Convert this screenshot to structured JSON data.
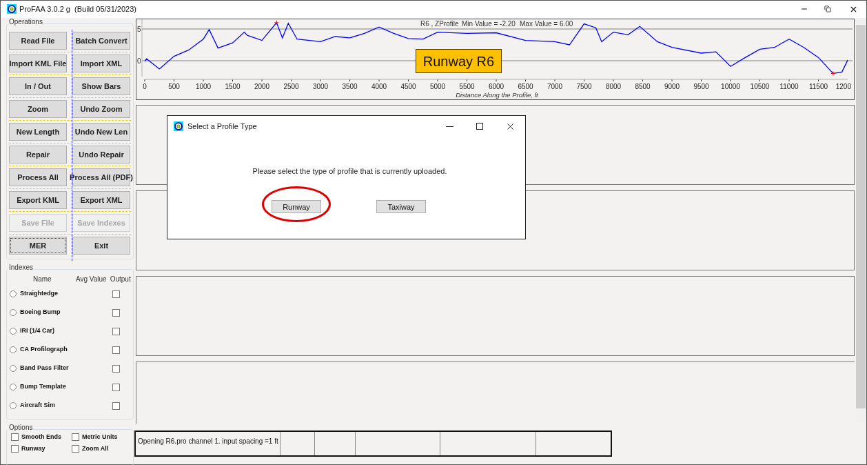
{
  "window": {
    "title": "ProFAA 3.0.2 g  (Build 05/31/2023)"
  },
  "operations": {
    "title": "Operations",
    "buttons": [
      {
        "label": "Read File",
        "disabled": false,
        "focused": false
      },
      {
        "label": "Batch Convert",
        "disabled": false,
        "focused": false
      },
      {
        "label": "Import KML File",
        "disabled": false,
        "focused": false
      },
      {
        "label": "Import XML",
        "disabled": false,
        "focused": false
      },
      {
        "label": "In / Out",
        "disabled": false,
        "focused": false
      },
      {
        "label": "Show Bars",
        "disabled": false,
        "focused": false
      },
      {
        "label": "Zoom",
        "disabled": false,
        "focused": false
      },
      {
        "label": "Undo Zoom",
        "disabled": false,
        "focused": false
      },
      {
        "label": "New Length",
        "disabled": false,
        "focused": false
      },
      {
        "label": "Undo New Len",
        "disabled": false,
        "focused": false
      },
      {
        "label": "Repair",
        "disabled": false,
        "focused": false
      },
      {
        "label": "Undo Repair",
        "disabled": false,
        "focused": false
      },
      {
        "label": "Process All",
        "disabled": false,
        "focused": false
      },
      {
        "label": "Process All (PDF)",
        "disabled": false,
        "focused": false
      },
      {
        "label": "Export KML",
        "disabled": false,
        "focused": false
      },
      {
        "label": "Export XML",
        "disabled": false,
        "focused": false
      },
      {
        "label": "Save File",
        "disabled": true,
        "focused": false
      },
      {
        "label": "Save Indexes",
        "disabled": true,
        "focused": false
      },
      {
        "label": "MER",
        "disabled": false,
        "focused": true
      },
      {
        "label": "Exit",
        "disabled": false,
        "focused": false
      }
    ]
  },
  "indexes": {
    "title": "Indexes",
    "columns": [
      "Name",
      "Avg Value",
      "Output"
    ],
    "rows": [
      {
        "name": "Straightedge",
        "selected": false,
        "output": false
      },
      {
        "name": "Boeing Bump",
        "selected": false,
        "output": false
      },
      {
        "name": "IRI (1/4 Car)",
        "selected": false,
        "output": false
      },
      {
        "name": "CA Profilograph",
        "selected": false,
        "output": false
      },
      {
        "name": "Band Pass Filter",
        "selected": false,
        "output": false
      },
      {
        "name": "Bump Template",
        "selected": false,
        "output": false
      },
      {
        "name": "Aircraft Sim",
        "selected": false,
        "output": false
      }
    ]
  },
  "options": {
    "title": "Options",
    "items": [
      {
        "label": "Smooth Ends",
        "checked": false
      },
      {
        "label": "Metric Units",
        "checked": false
      },
      {
        "label": "Runway",
        "checked": false
      },
      {
        "label": "Zoom All",
        "checked": false
      }
    ]
  },
  "profile_panel": {
    "overlay_label": "Runway R6",
    "chart_data": {
      "type": "line",
      "title": "R6 , ZProfile",
      "xlabel": "Distance Along the Profile, ft",
      "annotations": [
        "Min Value = -2.20",
        "Max Value = 6.00"
      ],
      "x": [
        0,
        30,
        250,
        500,
        750,
        1000,
        1100,
        1250,
        1500,
        1700,
        1750,
        2000,
        2250,
        2350,
        2450,
        2600,
        3000,
        3250,
        3500,
        3750,
        4000,
        4250,
        4500,
        4750,
        5000,
        5500,
        6000,
        6500,
        7000,
        7250,
        7500,
        7700,
        7800,
        8000,
        8250,
        8450,
        8750,
        9000,
        9500,
        9750,
        10000,
        10250,
        10500,
        10750,
        11000,
        11250,
        11500,
        11750,
        11900,
        12000
      ],
      "series": [
        {
          "color": "#0000ff",
          "values": [
            -0.1,
            0.3,
            -1.3,
            0.7,
            1.7,
            3.4,
            4.9,
            2.0,
            2.8,
            4.5,
            4.0,
            3.2,
            6.0,
            3.6,
            5.9,
            3.4,
            3.0,
            3.8,
            3.6,
            4.3,
            5.3,
            4.3,
            3.5,
            3.4,
            4.5,
            4.3,
            4.4,
            3.2,
            3.0,
            2.5,
            5.8,
            5.2,
            3.0,
            4.5,
            4.1,
            5.4,
            3.0,
            2.1,
            1.2,
            1.4,
            -0.9,
            0.5,
            1.8,
            2.1,
            3.4,
            2.1,
            0.5,
            -2.0,
            -1.8,
            0.1
          ]
        }
      ],
      "xlim": [
        0,
        12000
      ],
      "ylim": [
        -2.5,
        6.5
      ],
      "xticks": [
        0,
        500,
        1000,
        1500,
        2000,
        2500,
        3000,
        3500,
        4000,
        4500,
        5000,
        5500,
        6000,
        6500,
        7000,
        7500,
        8000,
        8500,
        9000,
        9500,
        10000,
        10500,
        11000,
        11500
      ],
      "yticks": [
        0,
        5
      ]
    },
    "cut_tick_label": "1200"
  },
  "dialog": {
    "title": "Select a Profile Type",
    "message": "Please select the type of profile that is currently uploaded.",
    "buttons": [
      {
        "label": "Runway",
        "highlighted": true
      },
      {
        "label": "Taxiway",
        "highlighted": false
      }
    ]
  },
  "status_bar": {
    "message": "Opening R6.pro channel 1. input spacing =1 ft"
  }
}
